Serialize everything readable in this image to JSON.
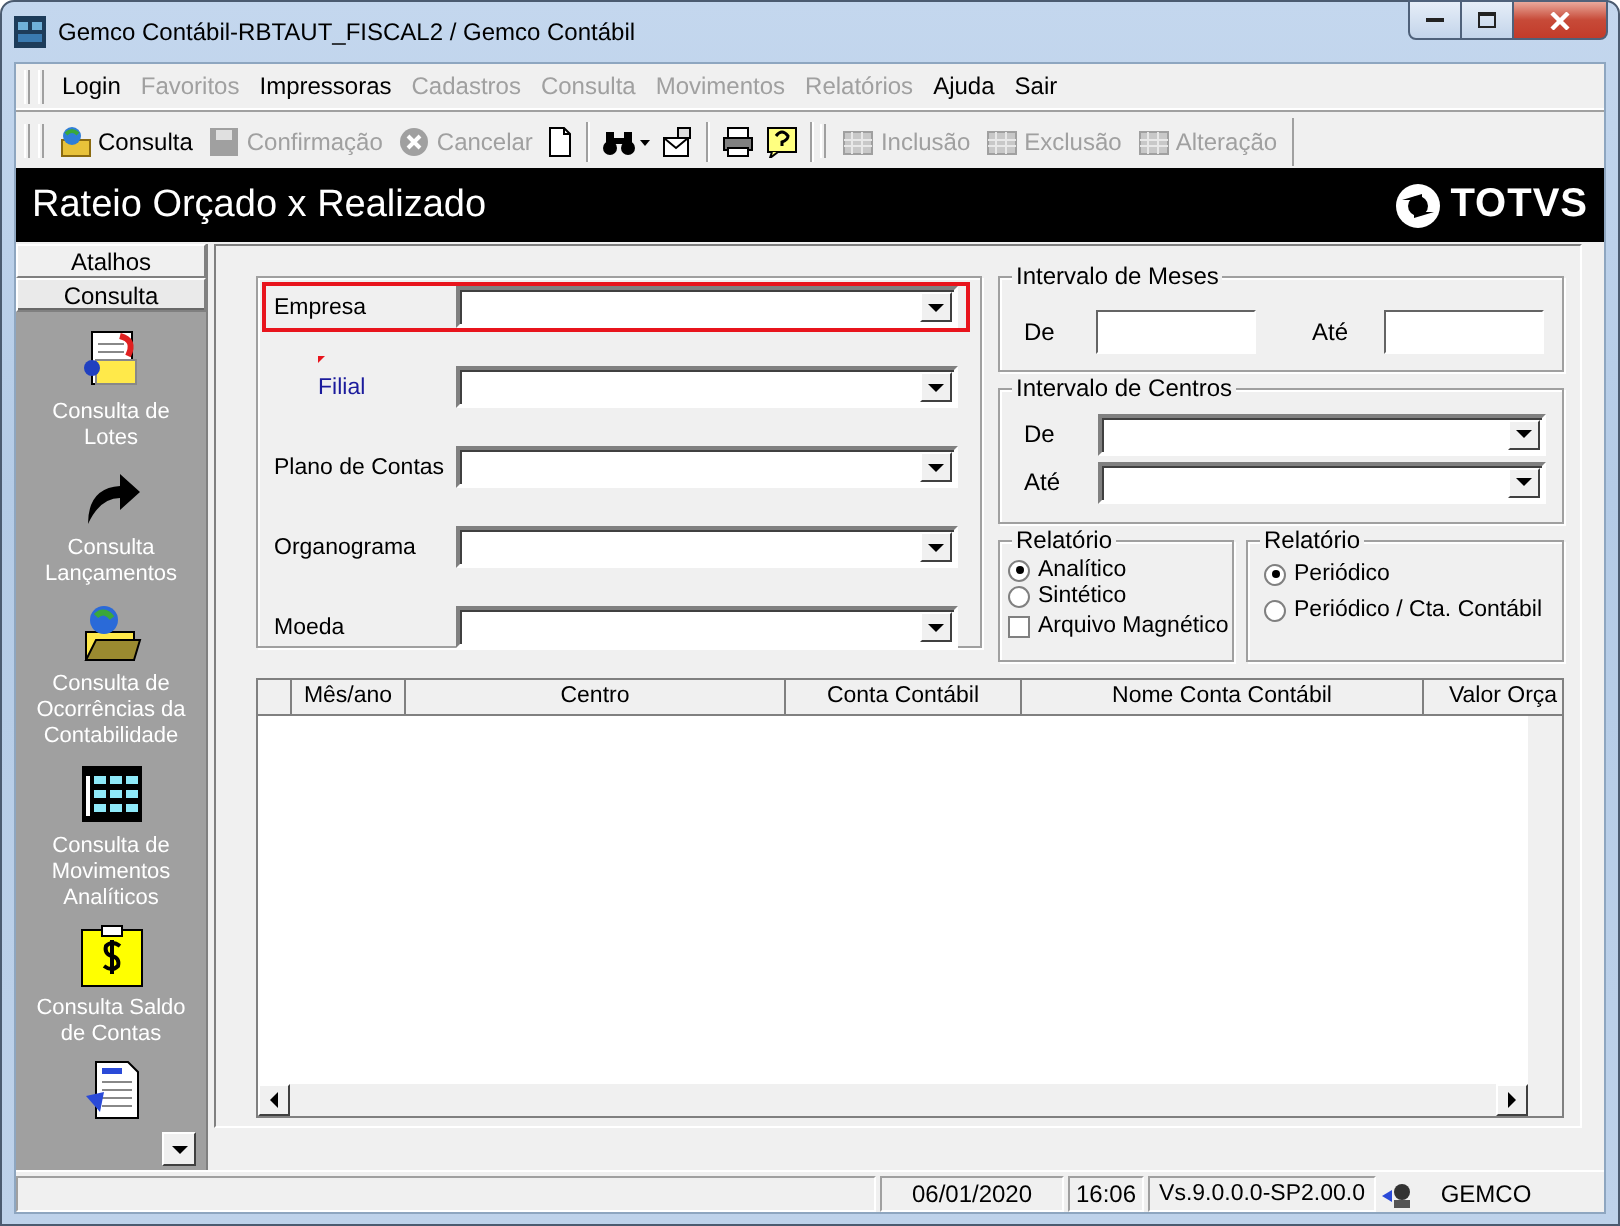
{
  "window": {
    "title": "Gemco Contábil-RBTAUT_FISCAL2 / Gemco Contábil"
  },
  "menu": [
    {
      "label": "Login",
      "disabled": false
    },
    {
      "label": "Favoritos",
      "disabled": true
    },
    {
      "label": "Impressoras",
      "disabled": false
    },
    {
      "label": "Cadastros",
      "disabled": true
    },
    {
      "label": "Consulta",
      "disabled": true
    },
    {
      "label": "Movimentos",
      "disabled": true
    },
    {
      "label": "Relatórios",
      "disabled": true
    },
    {
      "label": "Ajuda",
      "disabled": false
    },
    {
      "label": "Sair",
      "disabled": false
    }
  ],
  "toolbar": {
    "buttons": [
      {
        "label": "Consulta",
        "disabled": false
      },
      {
        "label": "Confirmação",
        "disabled": true
      },
      {
        "label": "Cancelar",
        "disabled": true
      }
    ],
    "record_buttons": [
      {
        "label": "Inclusão",
        "disabled": true
      },
      {
        "label": "Exclusão",
        "disabled": true
      },
      {
        "label": "Alteração",
        "disabled": true
      }
    ]
  },
  "header": {
    "title": "Rateio Orçado x Realizado",
    "logo": "TOTVS"
  },
  "sidebar": {
    "tabs": [
      {
        "label": "Atalhos",
        "selected": false
      },
      {
        "label": "Consulta",
        "selected": true
      }
    ],
    "items": [
      {
        "label": "Consulta de Lotes"
      },
      {
        "label": "Consulta Lançamentos"
      },
      {
        "label": "Consulta de Ocorrências da Contabilidade"
      },
      {
        "label": "Consulta de Movimentos Analíticos"
      },
      {
        "label": "Consulta Saldo de Contas"
      }
    ]
  },
  "form": {
    "fields": [
      {
        "label": "Empresa",
        "focused": true,
        "required": false
      },
      {
        "label": "Filial",
        "focused": false,
        "required": true
      },
      {
        "label": "Plano de Contas",
        "focused": false,
        "required": false
      },
      {
        "label": "Organograma",
        "focused": false,
        "required": false
      },
      {
        "label": "Moeda",
        "focused": false,
        "required": false
      }
    ]
  },
  "month_range": {
    "title": "Intervalo de Meses",
    "from_label": "De",
    "to_label": "Até"
  },
  "center_range": {
    "title": "Intervalo de Centros",
    "from_label": "De",
    "to_label": "Até"
  },
  "report_type": {
    "title": "Relatório",
    "options": [
      {
        "label": "Analítico",
        "selected": true
      },
      {
        "label": "Sintético",
        "selected": false
      }
    ],
    "checkbox": {
      "label": "Arquivo Magnético",
      "checked": false
    }
  },
  "report_period": {
    "title": "Relatório",
    "options": [
      {
        "label": "Periódico",
        "selected": true
      },
      {
        "label": "Periódico / Cta. Contábil",
        "selected": false
      }
    ]
  },
  "table": {
    "columns": [
      "Mês/ano",
      "Centro",
      "Conta Contábil",
      "Nome Conta Contábil",
      "Valor Orça"
    ]
  },
  "status_bar": {
    "date": "06/01/2020",
    "time": "16:06",
    "version": "Vs.9.0.0.0-SP2.00.0",
    "user": "GEMCO"
  }
}
